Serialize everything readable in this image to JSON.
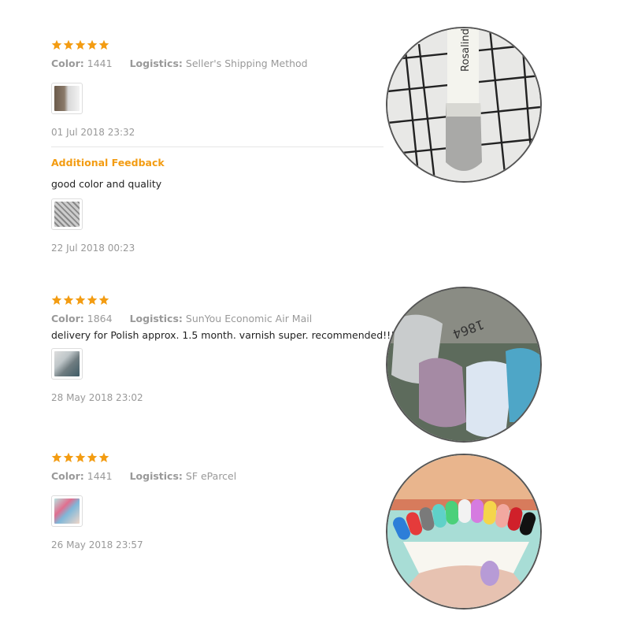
{
  "colors": {
    "star": "#f39c12",
    "accent": "#f39c12",
    "muted": "#999999"
  },
  "labels": {
    "color": "Color:",
    "logistics": "Logistics:"
  },
  "reviews": [
    {
      "rating": 5,
      "color": "1441",
      "logistics": "Seller's Shipping Method",
      "text": "",
      "thumbnail": "nail-polish-photo",
      "date": "01 Jul 2018 23:32",
      "additional": {
        "title": "Additional Feedback",
        "text": "good color and quality",
        "thumbnail": "nail-swatch-photo",
        "date": "22 Jul 2018 00:23"
      },
      "photo": "gray-nail-swatch-photo",
      "photo_text": "Rosalind"
    },
    {
      "rating": 5,
      "color": "1864",
      "logistics": "SunYou Economic Air Mail",
      "text": "delivery for Polish approx. 1.5 month. varnish super. recommended!!!!",
      "thumbnail": "glitter-swatch-photo",
      "date": "28 May 2018 23:02",
      "photo": "glitter-nail-swatches-photo",
      "photo_text": "1864"
    },
    {
      "rating": 5,
      "color": "1441",
      "logistics": "SF eParcel",
      "text": "",
      "thumbnail": "color-fan-photo",
      "date": "26 May 2018 23:57",
      "photo": "color-nail-fan-photo"
    }
  ]
}
